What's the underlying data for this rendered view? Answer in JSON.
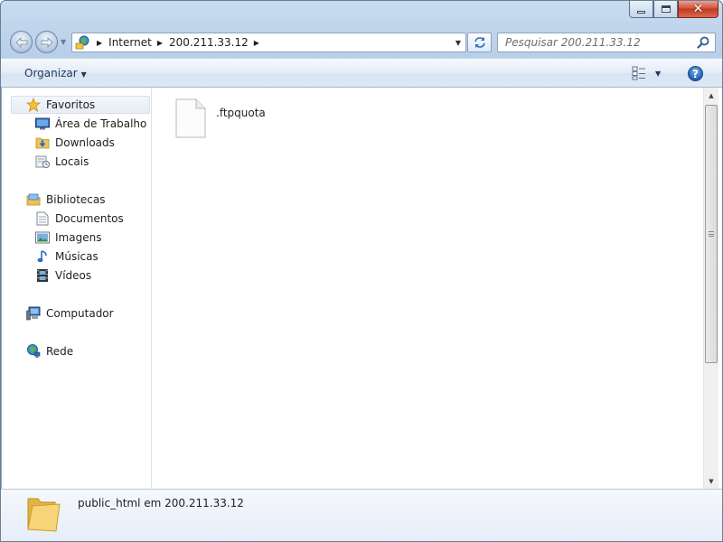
{
  "window": {
    "title": "",
    "controls": {
      "minimize": "minimize",
      "maximize": "maximize",
      "close": "close"
    }
  },
  "address": {
    "segments": [
      "Internet",
      "200.211.33.12"
    ]
  },
  "search": {
    "placeholder": "Pesquisar 200.211.33.12"
  },
  "toolbar": {
    "organize_label": "Organizar",
    "help_label": "?"
  },
  "sidebar": {
    "favorites": {
      "label": "Favoritos",
      "items": [
        {
          "label": "Área de Trabalho",
          "icon": "desktop-icon"
        },
        {
          "label": "Downloads",
          "icon": "downloads-folder-icon"
        },
        {
          "label": "Locais",
          "icon": "recent-places-icon"
        }
      ]
    },
    "libraries": {
      "label": "Bibliotecas",
      "items": [
        {
          "label": "Documentos",
          "icon": "documents-icon"
        },
        {
          "label": "Imagens",
          "icon": "pictures-icon"
        },
        {
          "label": "Músicas",
          "icon": "music-icon"
        },
        {
          "label": "Vídeos",
          "icon": "videos-icon"
        }
      ]
    },
    "computer": {
      "label": "Computador"
    },
    "network": {
      "label": "Rede"
    }
  },
  "files": [
    {
      "name": ".ftpquota",
      "icon": "file-icon"
    }
  ],
  "details": {
    "text": "public_html em 200.211.33.12"
  },
  "colors": {
    "frame": "#b7cfe8",
    "close_button": "#c0391f",
    "help_button": "#1f5fb3"
  }
}
